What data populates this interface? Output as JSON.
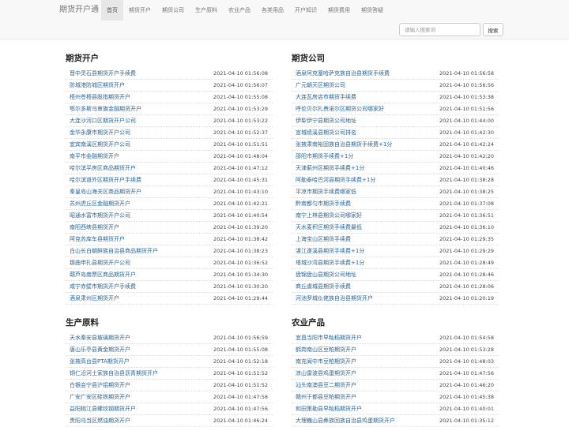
{
  "brand": "期货开户通",
  "nav": [
    "首页",
    "期货开户",
    "期货公司",
    "生产原料",
    "农业产品",
    "各类用品",
    "开户知识",
    "期货费用",
    "期货答疑"
  ],
  "search": {
    "placeholder": "请输入搜索词",
    "button": "搜索"
  },
  "sections": [
    {
      "title": "期货开户",
      "items": [
        {
          "text": "晋中灵石县期货开户手续费",
          "date": "2021-04-10 01:56:08"
        },
        {
          "text": "防城港防城区期货开户",
          "date": "2021-04-10 01:56:07"
        },
        {
          "text": "梧州苍梧县股指期货开户",
          "date": "2021-04-10 01:55:08"
        },
        {
          "text": "鄂尔多斯乌审旗金融期货开户",
          "date": "2021-04-10 01:53:29"
        },
        {
          "text": "大连沙河口区期货开户公司",
          "date": "2021-04-10 01:53:22"
        },
        {
          "text": "金华永康市期货开户公司",
          "date": "2021-04-10 01:52:37"
        },
        {
          "text": "宜宾南溪区期货开户公司",
          "date": "2021-04-10 01:51:51"
        },
        {
          "text": "南平市金融期货开户",
          "date": "2021-04-10 01:48:04"
        },
        {
          "text": "哈尔滨平房区商品期货开户",
          "date": "2021-04-10 01:47:12"
        },
        {
          "text": "哈尔滨道外区期货开户手续费",
          "date": "2021-04-10 01:45:31"
        },
        {
          "text": "秦皇岛山海关区商品期货开户",
          "date": "2021-04-10 01:43:10"
        },
        {
          "text": "苏州虎丘区金融期货开户",
          "date": "2021-04-10 01:42:21"
        },
        {
          "text": "昭通水富市期货开户公司",
          "date": "2021-04-10 01:40:54"
        },
        {
          "text": "南阳西峡县期货开户",
          "date": "2021-04-10 01:39:20"
        },
        {
          "text": "阿克苏库车县期货开户",
          "date": "2021-04-10 01:38:42"
        },
        {
          "text": "白山长白朝鲜族自治县商品期货开户",
          "date": "2021-04-10 01:38:23"
        },
        {
          "text": "那曲申扎县期货开户公司",
          "date": "2021-04-10 01:36:52"
        },
        {
          "text": "葫芦岛南票区商品期货开户",
          "date": "2021-04-10 01:34:30"
        },
        {
          "text": "咸宁赤壁市期货开户手续费",
          "date": "2021-04-10 01:30:20"
        },
        {
          "text": "酒泉肃州区期货开户",
          "date": "2021-04-10 01:29:44"
        }
      ]
    },
    {
      "title": "期货公司",
      "items": [
        {
          "text": "酒泉阿克塞哈萨克族自治县期货手续费",
          "date": "2021-04-10 01:56:58"
        },
        {
          "text": "广元朝天区期货公司",
          "date": "2021-04-10 01:56:56"
        },
        {
          "text": "大连瓦房店市期货手续费",
          "date": "2021-04-10 01:53:38"
        },
        {
          "text": "呼伦贝尔扎赉诺尔区期货公司哪家好",
          "date": "2021-04-10 01:51:56"
        },
        {
          "text": "伊犁伊宁县期货公司地址",
          "date": "2021-04-10 01:44:00"
        },
        {
          "text": "宣城绩溪县期货公司排名",
          "date": "2021-04-10 01:42:30"
        },
        {
          "text": "张掖肃南裕固族自治县期货手续费+1分",
          "date": "2021-04-10 01:42:24"
        },
        {
          "text": "邵阳市期货手续费+1分",
          "date": "2021-04-10 01:42:20"
        },
        {
          "text": "天津蓟州区期货手续费+1分",
          "date": "2021-04-10 01:40:46"
        },
        {
          "text": "阿勒泰哈巴河县期货手续费+1分",
          "date": "2021-04-10 01:38:28"
        },
        {
          "text": "平凉市期货手续费哪家低",
          "date": "2021-04-10 01:38:25"
        },
        {
          "text": "黔南都匀市期货手续费",
          "date": "2021-04-10 01:37:08"
        },
        {
          "text": "南宁上林县期货公司哪家好",
          "date": "2021-04-10 01:36:51"
        },
        {
          "text": "天水麦积区期货手续费最低",
          "date": "2021-04-10 01:36:10"
        },
        {
          "text": "上海宝山区期货手续费",
          "date": "2021-04-10 01:29:35"
        },
        {
          "text": "湛江遂溪县期货手续费+1分",
          "date": "2021-04-10 01:29:29"
        },
        {
          "text": "塔城沙湾县期货手续费+1分",
          "date": "2021-04-10 01:28:49"
        },
        {
          "text": "盘锦盘山县期货公司地址",
          "date": "2021-04-10 01:28:46"
        },
        {
          "text": "商丘虞城县期货手续费",
          "date": "2021-04-10 01:28:06"
        },
        {
          "text": "河池罗城仫佬族自治县期货开户",
          "date": "2021-04-10 01:20:19"
        }
      ]
    },
    {
      "title": "生产原料",
      "items": [
        {
          "text": "天水秦安县玻璃期货开户",
          "date": "2021-04-10 01:56:59"
        },
        {
          "text": "唐山乐亭县黄金期货开户",
          "date": "2021-04-10 01:55:08"
        },
        {
          "text": "张掖高台县PTA期货开户",
          "date": "2021-04-10 01:52:18"
        },
        {
          "text": "铜仁沿河土家族自治县沥青期货开户",
          "date": "2021-04-10 01:51:52"
        },
        {
          "text": "白银会宁县沪铝期货开户",
          "date": "2021-04-10 01:51:52"
        },
        {
          "text": "广安广安区硅铁期货开户",
          "date": "2021-04-10 01:47:58"
        },
        {
          "text": "益阳桃江县螺纹钢期货开户",
          "date": "2021-04-10 01:47:56"
        },
        {
          "text": "贵阳乌当区燃油期货开户",
          "date": "2021-04-10 01:46:24"
        }
      ]
    },
    {
      "title": "农业产品",
      "items": [
        {
          "text": "宜昌当阳市早籼稻期货开户",
          "date": "2021-04-10 01:54:58"
        },
        {
          "text": "鹤岗南山区豆粕期货开户",
          "date": "2021-04-10 01:53:28"
        },
        {
          "text": "南充阆中市豆粕期货开户",
          "date": "2021-04-10 01:48:03"
        },
        {
          "text": "凉山雷波县鸡蛋期货开户",
          "date": "2021-04-10 01:47:56"
        },
        {
          "text": "汕头南澳县豆二期货开户",
          "date": "2021-04-10 01:46:20"
        },
        {
          "text": "赣州于都县豆粕期货开户",
          "date": "2021-04-10 01:45:38"
        },
        {
          "text": "和田策勒县早籼稻期货开户",
          "date": "2021-04-10 01:40:01"
        },
        {
          "text": "大理巍山县彝族回族自治县鸡蛋期货开户",
          "date": "2021-04-10 01:35:12"
        }
      ]
    }
  ]
}
